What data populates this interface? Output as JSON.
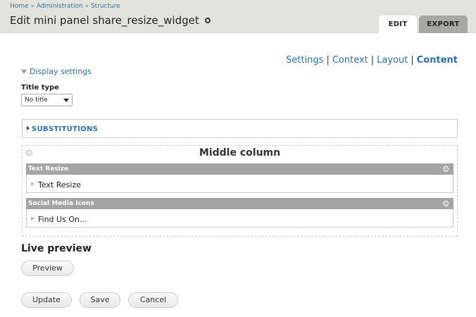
{
  "breadcrumb": {
    "items": [
      "Home",
      "Administration",
      "Structure"
    ],
    "separator": "»"
  },
  "page": {
    "title": "Edit mini panel share_resize_widget",
    "title_icon": "gear-icon"
  },
  "tabs": [
    {
      "label": "EDIT",
      "active": true
    },
    {
      "label": "EXPORT",
      "active": false
    }
  ],
  "subnav": {
    "items": [
      "Settings",
      "Context",
      "Layout",
      "Content"
    ],
    "active": "Content",
    "separator": "|"
  },
  "display_settings": {
    "label": "Display settings"
  },
  "title_type": {
    "label": "Title type",
    "value": "No title"
  },
  "substitutions": {
    "label": "SUBSTITUTIONS"
  },
  "region": {
    "title": "Middle column",
    "panes": [
      {
        "header": "Text Resize",
        "body": "Text Resize"
      },
      {
        "header": "Social Media Icons",
        "body": "Find Us On..."
      }
    ]
  },
  "live_preview": {
    "heading": "Live preview",
    "button": "Preview"
  },
  "actions": {
    "update": "Update",
    "save": "Save",
    "cancel": "Cancel"
  },
  "colors": {
    "link": "#2b6fb0",
    "header_bg": "#e3e3de",
    "pane_header_bg": "#a4a4a4",
    "tab_inactive_bg": "#a7a7a3"
  }
}
